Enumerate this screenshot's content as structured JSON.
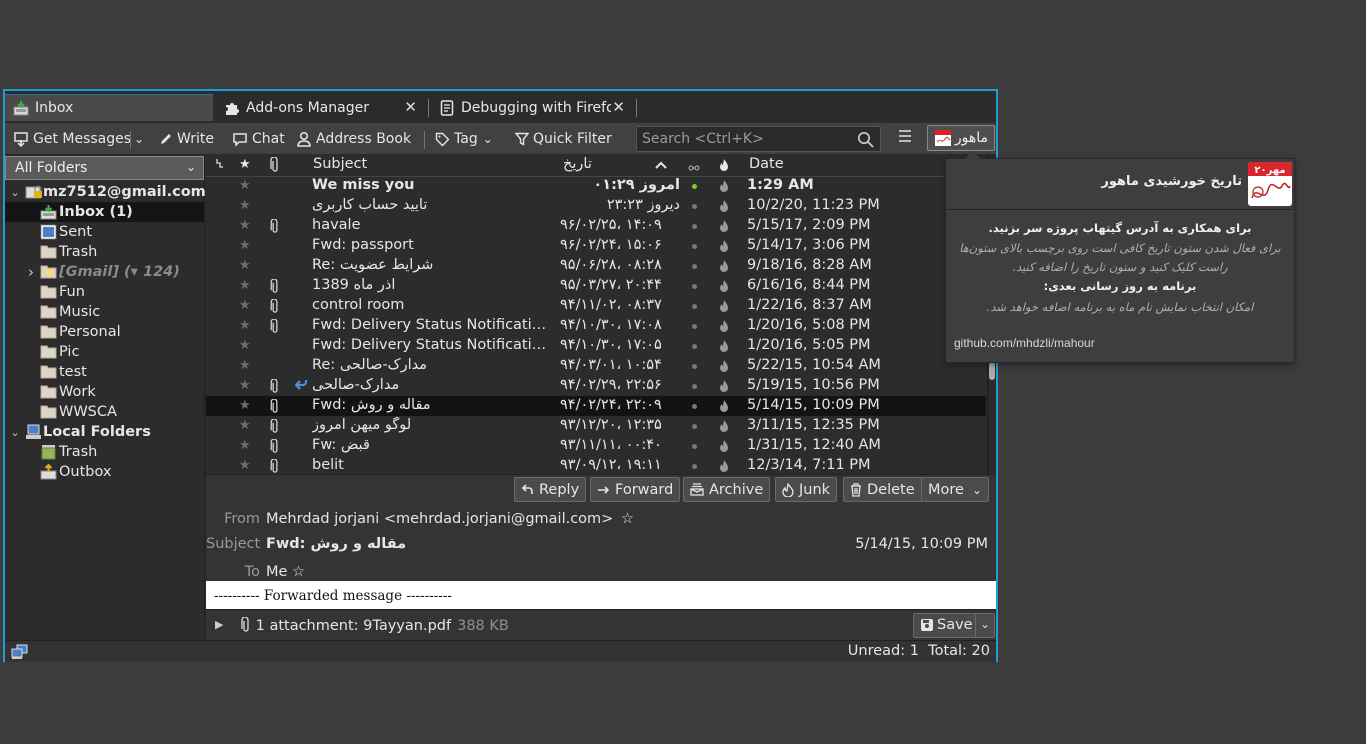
{
  "tabs": [
    {
      "label": "Inbox",
      "icon": "inbox-icon",
      "active": true
    },
    {
      "label": "Add-ons Manager",
      "icon": "puzzle-icon",
      "active": false
    },
    {
      "label": "Debugging with Firefox",
      "icon": "document-icon",
      "active": false
    }
  ],
  "toolbar": {
    "get_messages": "Get Messages",
    "write": "Write",
    "chat": "Chat",
    "address_book": "Address Book",
    "tag": "Tag",
    "quick_filter": "Quick Filter",
    "search_placeholder": "Search <Ctrl+K>",
    "mahour_label": "ماهور"
  },
  "folders": {
    "selector": "All Folders",
    "items": [
      {
        "label": "mz7512@gmail.com",
        "type": "account"
      },
      {
        "label": "Inbox (1)",
        "type": "inbox"
      },
      {
        "label": "Sent",
        "type": "sent"
      },
      {
        "label": "Trash",
        "type": "folder"
      },
      {
        "label": "[Gmail] (▾ 124)",
        "type": "gmail"
      },
      {
        "label": "Fun",
        "type": "folder"
      },
      {
        "label": "Music",
        "type": "folder"
      },
      {
        "label": "Personal",
        "type": "folder"
      },
      {
        "label": "Pic",
        "type": "folder"
      },
      {
        "label": "test",
        "type": "folder"
      },
      {
        "label": "Work",
        "type": "folder"
      },
      {
        "label": "WWSCA",
        "type": "folder"
      },
      {
        "label": "Local Folders",
        "type": "local"
      },
      {
        "label": "Trash",
        "type": "trash"
      },
      {
        "label": "Outbox",
        "type": "outbox"
      }
    ]
  },
  "columns": {
    "subject": "Subject",
    "persian_date": "تاریخ",
    "date": "Date"
  },
  "messages": [
    {
      "subject": "We miss you",
      "pdate": "امروز ۰۱:۲۹",
      "date": "1:29 AM",
      "attachment": false,
      "unread": true,
      "replied": false,
      "selected": false
    },
    {
      "subject": "تایید حساب کاربری",
      "pdate": "دیروز ۲۳:۲۳",
      "date": "10/2/20, 11:23 PM",
      "attachment": false,
      "unread": false,
      "replied": false,
      "selected": false
    },
    {
      "subject": "havale",
      "pdate": "۹۶/۰۲/۲۵، ۱۴:۰۹",
      "date": "5/15/17, 2:09 PM",
      "attachment": true,
      "unread": false,
      "replied": false,
      "selected": false
    },
    {
      "subject": "Fwd: passport",
      "pdate": "۹۶/۰۲/۲۴، ۱۵:۰۶",
      "date": "5/14/17, 3:06 PM",
      "attachment": false,
      "unread": false,
      "replied": false,
      "selected": false
    },
    {
      "subject": "Re: شرایط عضویت",
      "pdate": "۹۵/۰۶/۲۸، ۰۸:۲۸",
      "date": "9/18/16, 8:28 AM",
      "attachment": false,
      "unread": false,
      "replied": false,
      "selected": false
    },
    {
      "subject": "آذر ماه 1389",
      "pdate": "۹۵/۰۳/۲۷، ۲۰:۴۴",
      "date": "6/16/16, 8:44 PM",
      "attachment": true,
      "unread": false,
      "replied": false,
      "selected": false
    },
    {
      "subject": "control room",
      "pdate": "۹۴/۱۱/۰۲، ۰۸:۳۷",
      "date": "1/22/16, 8:37 AM",
      "attachment": true,
      "unread": false,
      "replied": false,
      "selected": false
    },
    {
      "subject": "Fwd: Delivery Status Notification (Failure)",
      "pdate": "۹۴/۱۰/۳۰، ۱۷:۰۸",
      "date": "1/20/16, 5:08 PM",
      "attachment": true,
      "unread": false,
      "replied": false,
      "selected": false
    },
    {
      "subject": "Fwd: Delivery Status Notification (Failure)",
      "pdate": "۹۴/۱۰/۳۰، ۱۷:۰۵",
      "date": "1/20/16, 5:05 PM",
      "attachment": false,
      "unread": false,
      "replied": false,
      "selected": false
    },
    {
      "subject": "Re: مدارک-صالحی",
      "pdate": "۹۴/۰۳/۰۱، ۱۰:۵۴",
      "date": "5/22/15, 10:54 AM",
      "attachment": false,
      "unread": false,
      "replied": false,
      "selected": false
    },
    {
      "subject": "مدارک-صالحی",
      "pdate": "۹۴/۰۲/۲۹، ۲۲:۵۶",
      "date": "5/19/15, 10:56 PM",
      "attachment": true,
      "unread": false,
      "replied": true,
      "selected": false
    },
    {
      "subject": "Fwd: مقاله و روش",
      "pdate": "۹۴/۰۲/۲۴، ۲۲:۰۹",
      "date": "5/14/15, 10:09 PM",
      "attachment": true,
      "unread": false,
      "replied": false,
      "selected": true
    },
    {
      "subject": "لوگو میهن امروز",
      "pdate": "۹۳/۱۲/۲۰، ۱۲:۳۵",
      "date": "3/11/15, 12:35 PM",
      "attachment": true,
      "unread": false,
      "replied": false,
      "selected": false
    },
    {
      "subject": "Fw: قبض",
      "pdate": "۹۳/۱۱/۱۱، ۰۰:۴۰",
      "date": "1/31/15, 12:40 AM",
      "attachment": true,
      "unread": false,
      "replied": false,
      "selected": false
    },
    {
      "subject": "belit",
      "pdate": "۹۳/۰۹/۱۲، ۱۹:۱۱",
      "date": "12/3/14, 7:11 PM",
      "attachment": true,
      "unread": false,
      "replied": false,
      "selected": false
    }
  ],
  "message_actions": {
    "reply": "Reply",
    "forward": "Forward",
    "archive": "Archive",
    "junk": "Junk",
    "delete": "Delete",
    "more": "More"
  },
  "message": {
    "from_label": "From",
    "from": "Mehrdad jorjani <mehrdad.jorjani@gmail.com>",
    "subject_label": "Subject",
    "subject": "Fwd: مقاله و روش",
    "date": "5/14/15, 10:09 PM",
    "to_label": "To",
    "to": "Me",
    "body": "---------- Forwarded message ----------",
    "attachment_text": "1 attachment: 9Tayyan.pdf",
    "attachment_size": "388 KB",
    "save": "Save"
  },
  "status": {
    "counts": "Unread: 1  Total: 20"
  },
  "popup": {
    "title": "تاریخ خورشیدی ماهور",
    "logo_text": "مهر۲۰",
    "line1": "برای همکاری به آدرس گیتهاب پروژه سر بزنید.",
    "line2": "برای فعال شدن ستون تاریخ کافی است روی برچسب بالای ستون‌ها",
    "line3": "راست کلیک کنید و ستون تاریخ را اضافه کنید.",
    "line4": "برنامه به روز رسانی بعدی:",
    "line5": "امکان انتخاب نمایش نام ماه به برنامه اضافه خواهد شد.",
    "link": "github.com/mhdzli/mahour"
  },
  "colors": {
    "window_border": "#1aa0d6",
    "unread_dot": "#7ccf1f",
    "selected_row": "#131313"
  }
}
